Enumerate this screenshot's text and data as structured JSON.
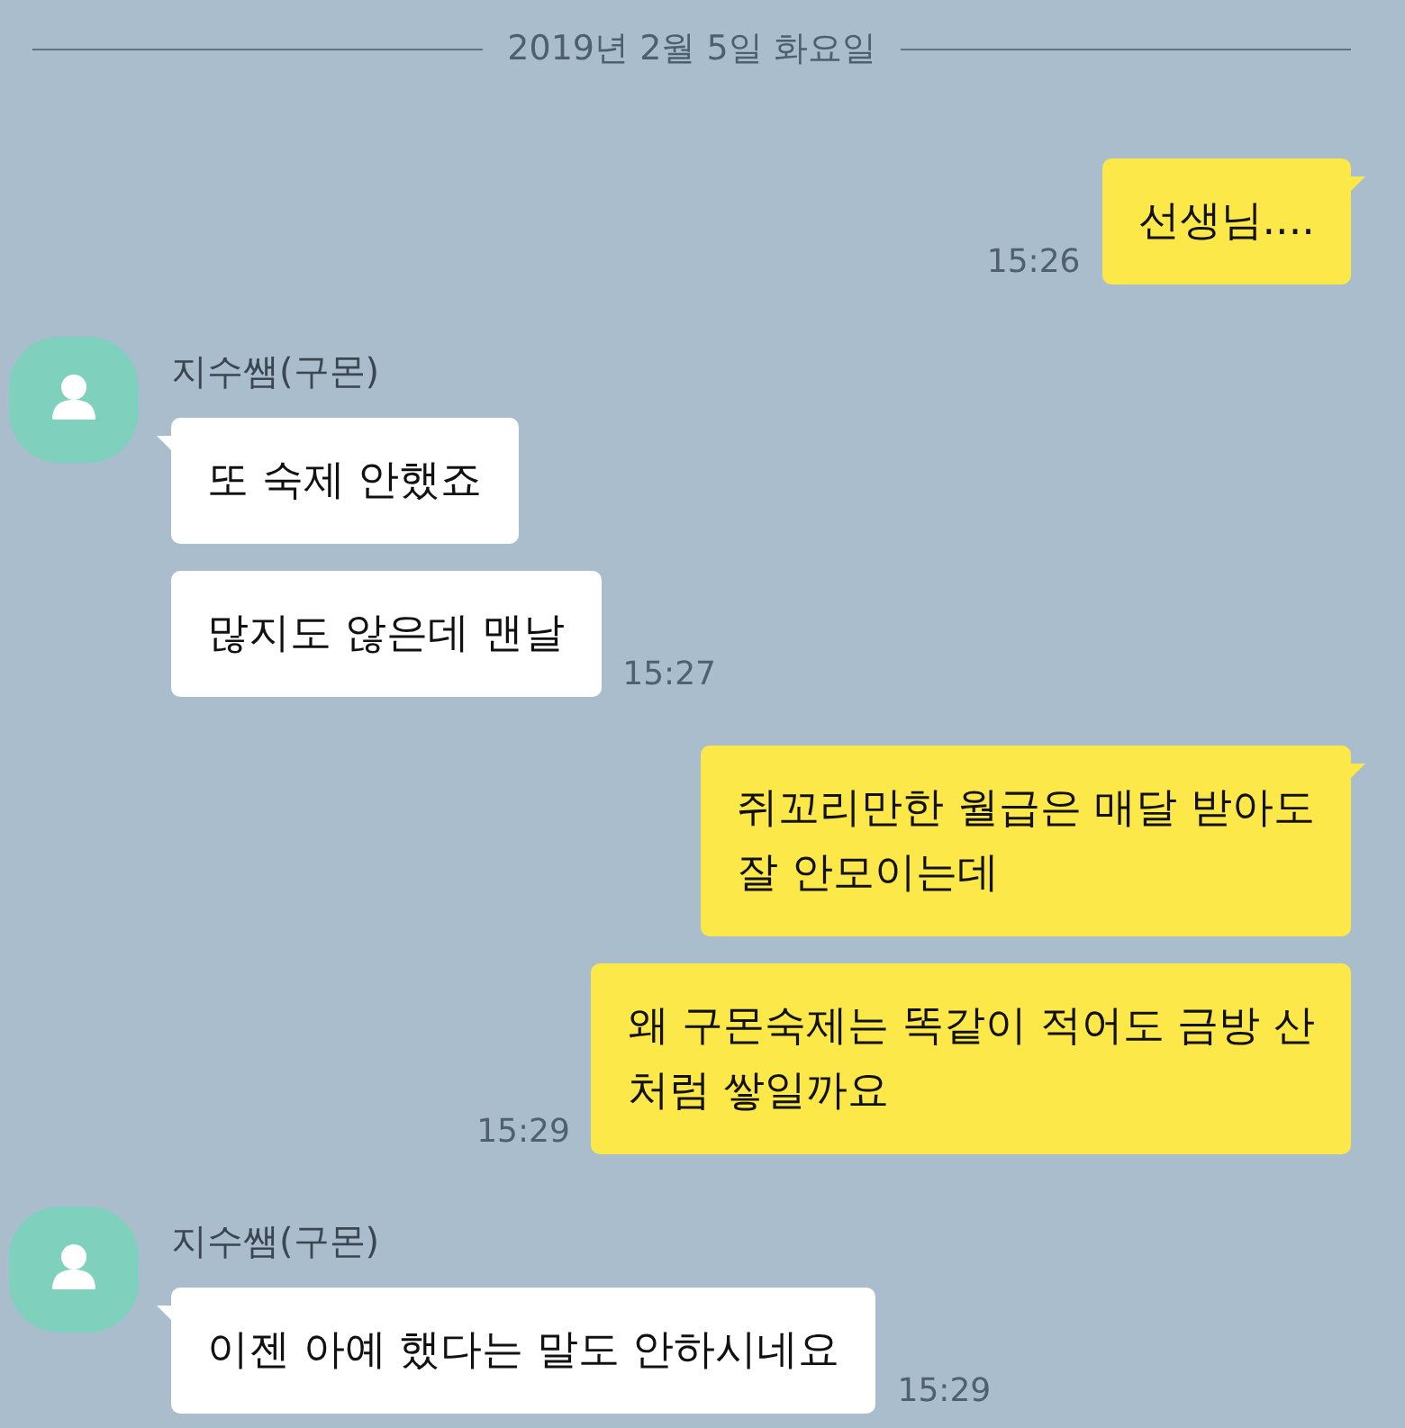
{
  "date_divider": "2019년 2월 5일 화요일",
  "messages": [
    {
      "kind": "outgoing",
      "bubbles": [
        "선생님...."
      ],
      "time": "15:26"
    },
    {
      "kind": "incoming",
      "sender": "지수쌤(구몬)",
      "bubbles": [
        "또 숙제 안했죠",
        "많지도 않은데 맨날"
      ],
      "time": "15:27"
    },
    {
      "kind": "outgoing",
      "bubbles": [
        "쥐꼬리만한 월급은 매달 받아도\n잘 안모이는데",
        "왜 구몬숙제는 똑같이 적어도 금방 산\n처럼 쌓일까요"
      ],
      "time": "15:29"
    },
    {
      "kind": "incoming",
      "sender": "지수쌤(구몬)",
      "bubbles": [
        "이젠 아예 했다는 말도 안하시네요"
      ],
      "time": "15:29"
    }
  ]
}
